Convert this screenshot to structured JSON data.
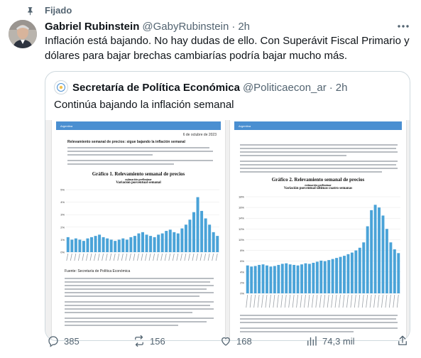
{
  "pinned": {
    "label": "Fijado",
    "icon": "pin-icon"
  },
  "tweet": {
    "author_name": "Gabriel Rubinstein",
    "author_handle": "@GabyRubinstein",
    "separator": "·",
    "time": "2h",
    "text": "Inflación está bajando. No hay dudas de ello. Con Superávit Fiscal Primario y dólares para bajar brechas cambiarías podría bajar mucho más."
  },
  "quote": {
    "author_name": "Secretaría de Política Económica",
    "author_handle": "@Politicaecon_ar",
    "separator": "·",
    "time": "2h",
    "text": "Continúa bajando la inflación semanal"
  },
  "doc1": {
    "band": "Argentina",
    "date": "6 de octubre de 2023",
    "heading": "Relevamiento semanal de precios: sigue bajando la inflación semanal",
    "chart_title": "Gráfico 1. Relevamiento semanal de precios",
    "chart_sub1": "estimación preliminar",
    "chart_sub2": "Variación porcentual semanal",
    "footer": "Fuente: Secretaría de Política Económica"
  },
  "doc2": {
    "band": "Argentina",
    "chart_title": "Gráfico 2. Relevamiento semanal de precios",
    "chart_sub1": "estimación preliminar",
    "chart_sub2": "Variación porcentual últimas cuatro semanas"
  },
  "chart_data": [
    {
      "type": "bar",
      "title": "Gráfico 1. Relevamiento semanal de precios",
      "subtitle": "Variación porcentual semanal",
      "ylim": [
        0,
        5
      ],
      "yticks": [
        "0%",
        "1%",
        "2%",
        "3%",
        "4%",
        "5%"
      ],
      "color": "#4aa3d8",
      "values": [
        1.2,
        1.0,
        1.1,
        1.0,
        0.9,
        1.1,
        1.2,
        1.3,
        1.4,
        1.2,
        1.1,
        1.0,
        0.9,
        1.0,
        1.1,
        1.0,
        1.2,
        1.3,
        1.5,
        1.6,
        1.4,
        1.3,
        1.2,
        1.4,
        1.5,
        1.7,
        1.8,
        1.6,
        1.5,
        1.9,
        2.2,
        2.6,
        3.2,
        4.4,
        3.3,
        2.7,
        2.2,
        1.6,
        1.3
      ]
    },
    {
      "type": "bar",
      "title": "Gráfico 2. Relevamiento semanal de precios",
      "subtitle": "Variación porcentual últimas cuatro semanas",
      "ylim": [
        0,
        18
      ],
      "yticks": [
        "0%",
        "2%",
        "4%",
        "6%",
        "8%",
        "10%",
        "12%",
        "14%",
        "16%",
        "18%"
      ],
      "color": "#4aa3d8",
      "values": [
        5.2,
        5.0,
        5.1,
        5.3,
        5.4,
        5.2,
        5.0,
        5.1,
        5.3,
        5.5,
        5.6,
        5.4,
        5.3,
        5.2,
        5.4,
        5.6,
        5.5,
        5.7,
        5.9,
        6.1,
        6.0,
        6.2,
        6.4,
        6.6,
        6.8,
        7.0,
        7.3,
        7.6,
        8.0,
        8.5,
        9.5,
        12.5,
        15.5,
        16.5,
        16.0,
        14.5,
        12.0,
        9.5,
        8.2,
        7.5
      ]
    }
  ],
  "actions": {
    "replies": "385",
    "reposts": "156",
    "likes": "168",
    "views": "74,3 mil"
  },
  "colors": {
    "secondary_text": "#536471",
    "border": "#cfd9de",
    "bars": "#4aa3d8"
  }
}
